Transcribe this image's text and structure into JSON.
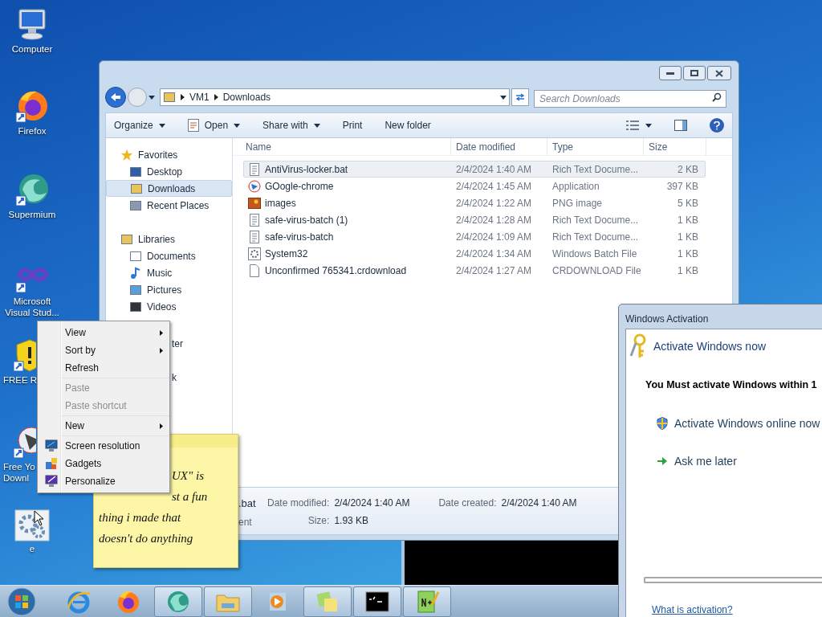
{
  "desktop_icons": [
    {
      "label": "Computer",
      "kind": "computer"
    },
    {
      "label": "Firefox",
      "kind": "firefox"
    },
    {
      "label": "Supermium",
      "kind": "supermium"
    },
    {
      "label": "Microsoft\nVisual Stud...",
      "kind": "infinity"
    },
    {
      "label": "FREE R",
      "kind": "shield"
    },
    {
      "label": "Free Yo\nDownl",
      "kind": "media"
    },
    {
      "label": "e",
      "kind": "gear"
    }
  ],
  "explorer": {
    "breadcrumb": [
      "VM1",
      "Downloads"
    ],
    "search": {
      "placeholder": "Search Downloads"
    },
    "toolbar": [
      {
        "label": "Organize",
        "has_menu": true,
        "kind": "plain"
      },
      {
        "label": "Open",
        "has_menu": true,
        "kind": "open"
      },
      {
        "label": "Share with",
        "has_menu": true,
        "kind": "plain"
      },
      {
        "label": "Print",
        "has_menu": false,
        "kind": "plain"
      },
      {
        "label": "New folder",
        "has_menu": false,
        "kind": "plain"
      }
    ],
    "nav": [
      {
        "label": "Favorites",
        "kind": "star",
        "children": [
          {
            "label": "Desktop",
            "kind": "desktop",
            "selected": false
          },
          {
            "label": "Downloads",
            "kind": "folder",
            "selected": true
          },
          {
            "label": "Recent Places",
            "kind": "recent",
            "selected": false
          }
        ]
      },
      {
        "label": "Libraries",
        "kind": "libraries",
        "children": [
          {
            "label": "Documents",
            "kind": "document",
            "selected": false
          },
          {
            "label": "Music",
            "kind": "music",
            "selected": false
          },
          {
            "label": "Pictures",
            "kind": "picture",
            "selected": false
          },
          {
            "label": "Videos",
            "kind": "video",
            "selected": false
          }
        ]
      }
    ],
    "nav_fragments": [
      "ter",
      "k"
    ],
    "columns": [
      "Name",
      "Date modified",
      "Type",
      "Size"
    ],
    "rows": [
      {
        "name": "AntiVirus-locker.bat",
        "date": "2/4/2024 1:40 AM",
        "type": "Rich Text Docume...",
        "size": "2 KB",
        "kind": "text",
        "selected": true
      },
      {
        "name": "GOogle-chrome",
        "date": "2/4/2024 1:45 AM",
        "type": "Application",
        "size": "397 KB",
        "kind": "app",
        "selected": false
      },
      {
        "name": "images",
        "date": "2/4/2024 1:22 AM",
        "type": "PNG image",
        "size": "5 KB",
        "kind": "image",
        "selected": false
      },
      {
        "name": "safe-virus-batch (1)",
        "date": "2/4/2024 1:28 AM",
        "type": "Rich Text Docume...",
        "size": "1 KB",
        "kind": "text",
        "selected": false
      },
      {
        "name": "safe-virus-batch",
        "date": "2/4/2024 1:09 AM",
        "type": "Rich Text Docume...",
        "size": "1 KB",
        "kind": "text",
        "selected": false
      },
      {
        "name": "System32",
        "date": "2/4/2024 1:34 AM",
        "type": "Windows Batch File",
        "size": "1 KB",
        "kind": "batch",
        "selected": false
      },
      {
        "name": "Unconfirmed 765341.crdownload",
        "date": "2/4/2024 1:27 AM",
        "type": "CRDOWNLOAD File",
        "size": "1 KB",
        "kind": "blank",
        "selected": false
      }
    ],
    "details": {
      "fragments": [
        ".bat",
        "ent"
      ],
      "fields": [
        {
          "label": "Date modified:",
          "value": "2/4/2024 1:40 AM"
        },
        {
          "label": "Date created:",
          "value": "2/4/2024 1:40 AM"
        },
        {
          "label": "Size:",
          "value": "1.93 KB"
        }
      ]
    }
  },
  "context_menu": {
    "groups": [
      [
        {
          "label": "View",
          "submenu": true,
          "disabled": false
        },
        {
          "label": "Sort by",
          "submenu": true,
          "disabled": false
        },
        {
          "label": "Refresh",
          "submenu": false,
          "disabled": false
        }
      ],
      [
        {
          "label": "Paste",
          "submenu": false,
          "disabled": true
        },
        {
          "label": "Paste shortcut",
          "submenu": false,
          "disabled": true
        }
      ],
      [
        {
          "label": "New",
          "submenu": true,
          "disabled": false
        }
      ],
      [
        {
          "label": "Screen resolution",
          "submenu": false,
          "disabled": false,
          "kind": "resolution"
        },
        {
          "label": "Gadgets",
          "submenu": false,
          "disabled": false,
          "kind": "gadgets"
        },
        {
          "label": "Personalize",
          "submenu": false,
          "disabled": false,
          "kind": "personalize"
        }
      ]
    ]
  },
  "sticky_note": {
    "lines": [
      "UX\" is",
      "st a fun",
      "thing i made that",
      "doesn't do anything"
    ]
  },
  "activation": {
    "title": "Windows Activation",
    "heading": "Activate Windows now",
    "message": "You Must activate Windows within 1",
    "options": [
      {
        "label": "Activate Windows online now",
        "kind": "shield"
      },
      {
        "label": "Ask me later",
        "kind": "arrow"
      }
    ],
    "link": "What is activation?"
  },
  "taskbar": {
    "apps": [
      {
        "kind": "ie",
        "running": false
      },
      {
        "kind": "firefox",
        "running": false
      },
      {
        "kind": "supermium",
        "running": true
      },
      {
        "kind": "explorer",
        "running": true
      },
      {
        "kind": "media",
        "running": false
      },
      {
        "kind": "sticky",
        "running": true
      },
      {
        "kind": "console",
        "running": true
      },
      {
        "kind": "notepad",
        "running": true
      }
    ]
  }
}
